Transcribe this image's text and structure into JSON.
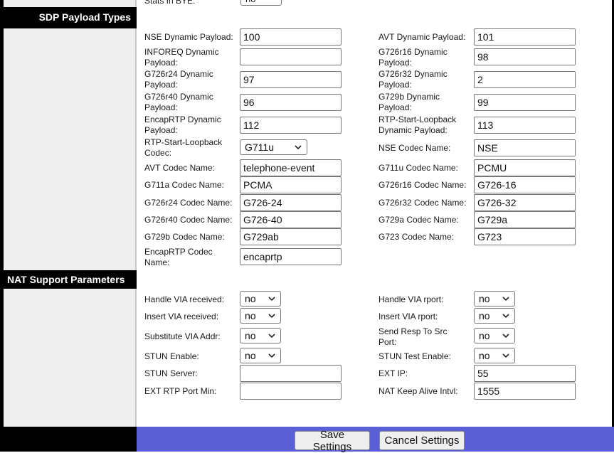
{
  "sections": {
    "sdp": "SDP Payload Types",
    "nat": "NAT Support Parameters"
  },
  "top_partial": {
    "label": "Stats In BYE:",
    "value": "no"
  },
  "fields": {
    "nse_dyn": {
      "label": "NSE Dynamic Payload:",
      "value": "100"
    },
    "avt_dyn": {
      "label": "AVT Dynamic Payload:",
      "value": "101"
    },
    "inforeq_dyn": {
      "label1": "INFOREQ Dynamic",
      "label2": "Payload:",
      "value": ""
    },
    "g726r16_dyn": {
      "label1": "G726r16 Dynamic",
      "label2": "Payload:",
      "value": "98"
    },
    "g726r24_dyn": {
      "label1": "G726r24 Dynamic",
      "label2": "Payload:",
      "value": "97"
    },
    "g726r32_dyn": {
      "label1": "G726r32 Dynamic",
      "label2": "Payload:",
      "value": "2"
    },
    "g726r40_dyn": {
      "label1": "G726r40 Dynamic",
      "label2": "Payload:",
      "value": "96"
    },
    "g729b_dyn": {
      "label1": "G729b Dynamic",
      "label2": "Payload:",
      "value": "99"
    },
    "encaprtp_dyn": {
      "label1": "EncapRTP Dynamic",
      "label2": "Payload:",
      "value": "112"
    },
    "rtp_loop_dyn": {
      "label1": "RTP-Start-Loopback",
      "label2": "Dynamic Payload:",
      "value": "113"
    },
    "rtp_loop_codec": {
      "label1": "RTP-Start-Loopback",
      "label2": "Codec:",
      "value": "G711u"
    },
    "nse_codec": {
      "label": "NSE Codec Name:",
      "value": "NSE"
    },
    "avt_codec": {
      "label": "AVT Codec Name:",
      "value": "telephone-event"
    },
    "g711u_codec": {
      "label": "G711u Codec Name:",
      "value": "PCMU"
    },
    "g711a_codec": {
      "label": "G711a Codec Name:",
      "value": "PCMA"
    },
    "g726r16_codec": {
      "label": "G726r16 Codec Name:",
      "value": "G726-16"
    },
    "g726r24_codec": {
      "label": "G726r24 Codec Name:",
      "value": "G726-24"
    },
    "g726r32_codec": {
      "label": "G726r32 Codec Name:",
      "value": "G726-32"
    },
    "g726r40_codec": {
      "label": "G726r40 Codec Name:",
      "value": "G726-40"
    },
    "g729a_codec": {
      "label": "G729a Codec Name:",
      "value": "G729a"
    },
    "g729b_codec": {
      "label": "G729b Codec Name:",
      "value": "G729ab"
    },
    "g723_codec": {
      "label": "G723 Codec Name:",
      "value": "G723"
    },
    "encaprtp_codec": {
      "label1": "EncapRTP Codec",
      "label2": "Name:",
      "value": "encaprtp"
    },
    "handle_via_received": {
      "label": "Handle VIA received:",
      "value": "no"
    },
    "handle_via_rport": {
      "label": "Handle VIA rport:",
      "value": "no"
    },
    "insert_via_received": {
      "label": "Insert VIA received:",
      "value": "no"
    },
    "insert_via_rport": {
      "label": "Insert VIA rport:",
      "value": "no"
    },
    "substitute_via_addr": {
      "label": "Substitute VIA Addr:",
      "value": "no"
    },
    "send_resp_src_port": {
      "label1": "Send Resp To Src",
      "label2": "Port:",
      "value": "no"
    },
    "stun_enable": {
      "label": "STUN Enable:",
      "value": "no"
    },
    "stun_test_enable": {
      "label": "STUN Test Enable:",
      "value": "no"
    },
    "stun_server": {
      "label": "STUN Server:",
      "value": ""
    },
    "ext_ip": {
      "label": "EXT IP:",
      "value": "55"
    },
    "ext_rtp_port_min": {
      "label": "EXT RTP Port Min:",
      "value": ""
    },
    "nat_keep_alive": {
      "label": "NAT Keep Alive Intvl:",
      "value": "1555"
    }
  },
  "buttons": {
    "save": "Save Settings",
    "cancel": "Cancel Settings"
  },
  "colors": {
    "footer_accent": "#5a5fd6",
    "section_bar": "#000000",
    "left_panel": "#efefef"
  },
  "icons": {
    "select_arrow": "chevron-down-icon"
  }
}
